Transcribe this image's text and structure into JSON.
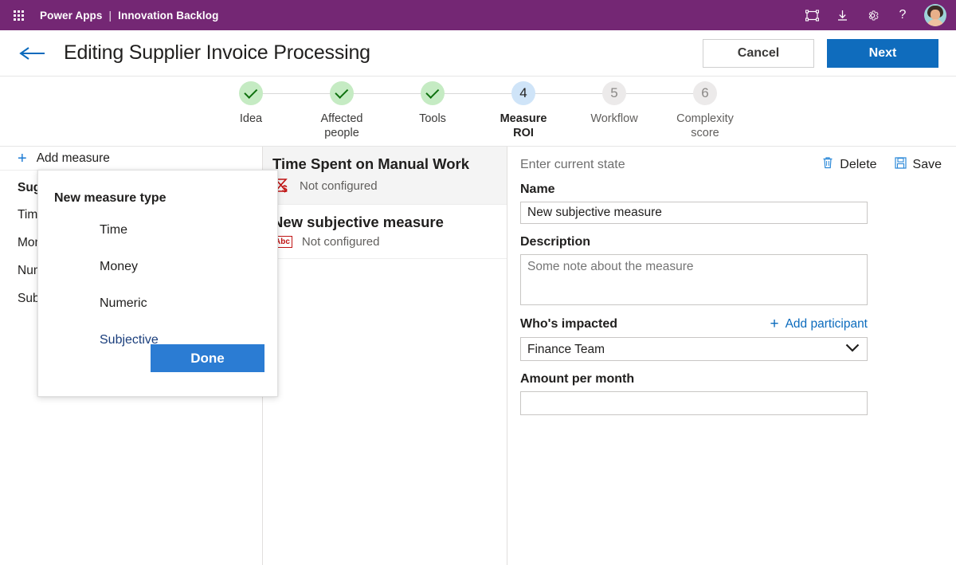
{
  "suitebar": {
    "waffle_icon": "waffle-grid-icon",
    "app_name": "Power Apps",
    "separator": "|",
    "context_name": "Innovation Backlog",
    "icons": [
      "frame-icon",
      "download-icon",
      "gear-icon",
      "help-icon"
    ],
    "help_glyph": "?",
    "avatar": "user-avatar",
    "brand_color": "#742774"
  },
  "commandbar": {
    "back_icon": "back-arrow-icon",
    "title": "Editing Supplier Invoice Processing",
    "cancel_label": "Cancel",
    "next_label": "Next",
    "primary_color": "#0f6cbd"
  },
  "stepper": {
    "steps": [
      {
        "number": "1",
        "label": "Idea",
        "state": "done"
      },
      {
        "number": "2",
        "label": "Affected\npeople",
        "state": "done"
      },
      {
        "number": "3",
        "label": "Tools",
        "state": "done"
      },
      {
        "number": "4",
        "label": "Measure\nROI",
        "state": "active"
      },
      {
        "number": "5",
        "label": "Workflow",
        "state": "upcoming"
      },
      {
        "number": "6",
        "label": "Complexity\nscore",
        "state": "upcoming"
      }
    ],
    "done_color": "#c5ebc3",
    "active_color": "#cfe4f8",
    "upcoming_color": "#eceaea"
  },
  "left_panel": {
    "add_measure_label": "Add measure",
    "add_icon": "plus-icon",
    "list": [
      {
        "label": "Suggested measures",
        "bold": true
      },
      {
        "label": "Time",
        "bold": false
      },
      {
        "label": "Money",
        "bold": false
      },
      {
        "label": "Numeric",
        "bold": false
      },
      {
        "label": "Subjective",
        "bold": false
      }
    ]
  },
  "measure_cards": [
    {
      "title": "Time Spent on Manual Work",
      "status": "Not configured",
      "icon": "hourglass-money-icon",
      "selected": true
    },
    {
      "title": "New subjective measure",
      "status": "Not configured",
      "icon": "abc-icon",
      "selected": false
    }
  ],
  "detail_panel": {
    "header_placeholder": "Enter current state",
    "delete_label": "Delete",
    "delete_icon": "trash-icon",
    "save_label": "Save",
    "save_icon": "save-disk-icon",
    "name_label": "Name",
    "name_value": "New subjective measure",
    "description_label": "Description",
    "description_placeholder": "Some note about the measure",
    "description_value": "",
    "impacted_label": "Who's impacted",
    "add_participant_label": "Add participant",
    "add_participant_icon": "plus-icon",
    "impacted_value": "Finance Team",
    "impacted_options": [
      "Finance Team"
    ],
    "dropdown_icon": "chevron-down-icon",
    "amount_label": "Amount per month",
    "amount_value": ""
  },
  "popup": {
    "title": "New measure type",
    "options": [
      {
        "label": "Time",
        "selected": false
      },
      {
        "label": "Money",
        "selected": false
      },
      {
        "label": "Numeric",
        "selected": false
      },
      {
        "label": "Subjective",
        "selected": true
      }
    ],
    "done_label": "Done",
    "done_color": "#2b7cd3"
  }
}
